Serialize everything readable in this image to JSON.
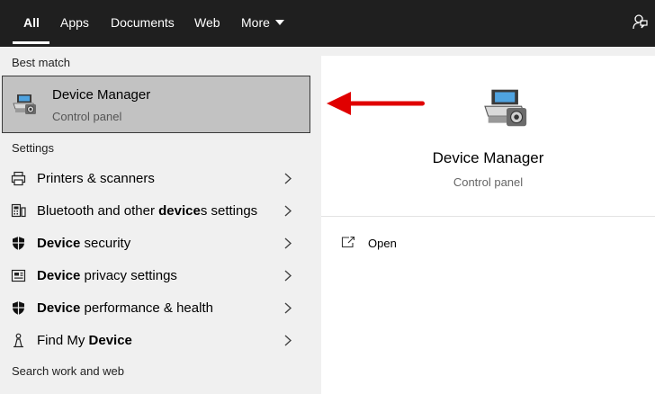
{
  "tabs": [
    {
      "label": "All"
    },
    {
      "label": "Apps"
    },
    {
      "label": "Documents"
    },
    {
      "label": "Web"
    },
    {
      "label": "More"
    }
  ],
  "sections": {
    "best_match": "Best match",
    "settings": "Settings",
    "search_web": "Search work and web"
  },
  "best_match": {
    "title": "Device Manager",
    "subtitle": "Control panel",
    "icon": "device-manager-icon"
  },
  "settings_items": [
    {
      "pre": "",
      "bold": "",
      "post": "Printers & scanners",
      "icon": "printer-icon"
    },
    {
      "pre": "Bluetooth and other ",
      "bold": "device",
      "post": "s settings",
      "icon": "bluetooth-devices-icon"
    },
    {
      "pre": "",
      "bold": "Device",
      "post": " security",
      "icon": "shield-icon"
    },
    {
      "pre": "",
      "bold": "Device",
      "post": " privacy settings",
      "icon": "privacy-icon"
    },
    {
      "pre": "",
      "bold": "Device",
      "post": " performance & health",
      "icon": "shield-icon"
    },
    {
      "pre": "Find My ",
      "bold": "Device",
      "post": "",
      "icon": "person-pin-icon"
    }
  ],
  "detail": {
    "title": "Device Manager",
    "subtitle": "Control panel",
    "open_label": "Open"
  },
  "colors": {
    "tab_bar": "#1f1f1f",
    "left_panel": "#f0f0f0",
    "selected": "#c2c2c2",
    "arrow": "#e00000"
  }
}
